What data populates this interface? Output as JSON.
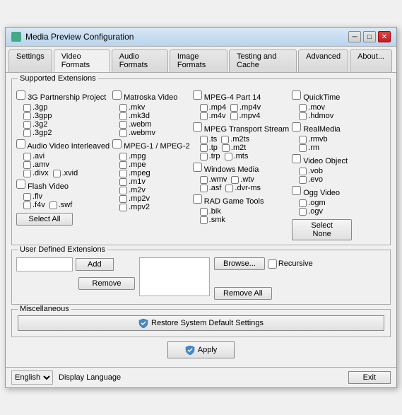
{
  "window": {
    "title": "Media Preview Configuration",
    "icon": "media-icon"
  },
  "tabs": [
    {
      "id": "settings",
      "label": "Settings"
    },
    {
      "id": "video-formats",
      "label": "Video Formats",
      "active": true
    },
    {
      "id": "audio-formats",
      "label": "Audio Formats"
    },
    {
      "id": "image-formats",
      "label": "Image Formats"
    },
    {
      "id": "testing-cache",
      "label": "Testing and Cache"
    },
    {
      "id": "advanced",
      "label": "Advanced"
    },
    {
      "id": "about",
      "label": "About..."
    }
  ],
  "supported_extensions": {
    "label": "Supported Extensions",
    "columns": {
      "col1": {
        "categories": [
          {
            "name": "3G Partnership Project",
            "exts": [
              ".3gp",
              ".3gpp",
              ".3g2",
              ".3gp2"
            ]
          },
          {
            "name": "Audio Video Interleaved",
            "exts": [
              ".avi",
              ".amv"
            ],
            "pairs": [
              [
                ".divx",
                ".xvid"
              ]
            ]
          },
          {
            "name": "Flash Video",
            "exts": [
              ".flv"
            ],
            "pairs": [
              [
                ".f4v",
                ".swf"
              ]
            ]
          }
        ]
      },
      "col2": {
        "categories": [
          {
            "name": "Matroska Video",
            "exts": [
              ".mkv",
              ".mk3d",
              ".webm",
              ".webmv"
            ]
          },
          {
            "name": "MPEG-1 / MPEG-2",
            "exts": [
              ".mpg",
              ".mpe",
              ".mpeg",
              ".m1v",
              ".m2v",
              ".mp2v",
              ".mpv2"
            ]
          }
        ]
      },
      "col3": {
        "categories": [
          {
            "name": "MPEG-4 Part 14",
            "exts": [],
            "pairs": [
              [
                ".mp4",
                ".mp4v"
              ],
              [
                ".m4v",
                ".mpv4"
              ]
            ]
          },
          {
            "name": "MPEG Transport Stream",
            "exts": [],
            "pairs": [
              [
                ".ts",
                ".m2ts"
              ],
              [
                ".tp",
                ".m2t"
              ],
              [
                ".trp",
                ".mts"
              ]
            ]
          },
          {
            "name": "Windows Media",
            "exts": [],
            "pairs": [
              [
                ".wmv",
                ".wtv"
              ],
              [
                ".asf",
                ".dvr-ms"
              ]
            ]
          },
          {
            "name": "RAD Game Tools",
            "exts": [
              ".bik",
              ".smk"
            ]
          }
        ]
      },
      "col4": {
        "categories": [
          {
            "name": "QuickTime",
            "exts": [
              ".mov",
              ".hdmov"
            ]
          },
          {
            "name": "RealMedia",
            "exts": [
              ".rmvb",
              ".rm"
            ]
          },
          {
            "name": "Video Object",
            "exts": [
              ".vob",
              ".evo"
            ]
          },
          {
            "name": "Ogg Video",
            "exts": [
              ".ogm",
              ".ogv"
            ]
          }
        ]
      }
    },
    "select_all": "Select All",
    "select_none": "Select None"
  },
  "user_defined": {
    "label": "User Defined Extensions",
    "input_placeholder": "",
    "add_label": "Add",
    "remove_label": "Remove",
    "browse_label": "Browse...",
    "recursive_label": "Recursive",
    "remove_all_label": "Remove All"
  },
  "miscellaneous": {
    "label": "Miscellaneous",
    "restore_label": "Restore System Default Settings"
  },
  "apply_label": "Apply",
  "bottom": {
    "language": "English",
    "display_language": "Display Language",
    "exit_label": "Exit"
  }
}
